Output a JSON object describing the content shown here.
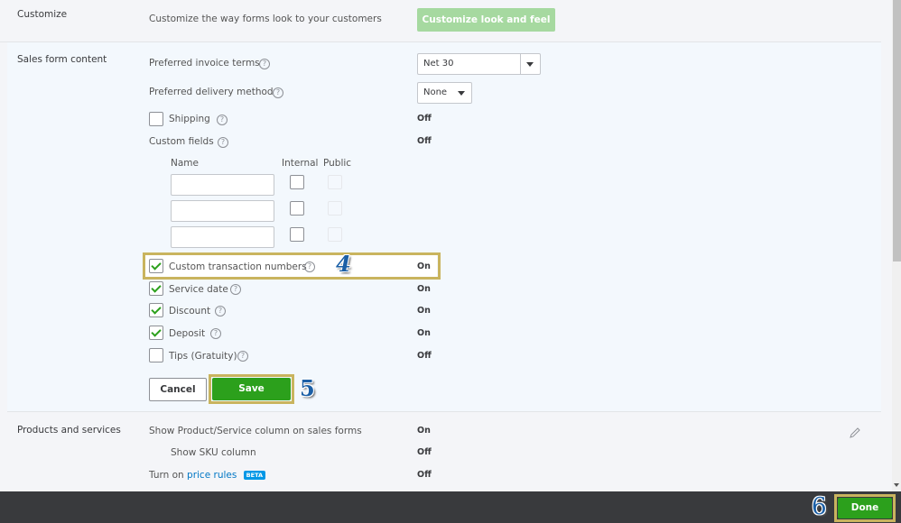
{
  "customize": {
    "section": "Customize",
    "description": "Customize the way forms look to your customers",
    "button": "Customize look and feel"
  },
  "sales": {
    "section": "Sales form content",
    "invoice_terms": {
      "label": "Preferred invoice terms",
      "value": "Net 30"
    },
    "delivery": {
      "label": "Preferred delivery method",
      "value": "None"
    },
    "shipping": {
      "label": "Shipping",
      "status": "Off",
      "checked": false
    },
    "custom_fields": {
      "label": "Custom fields",
      "status": "Off",
      "col_name": "Name",
      "col_internal": "Internal",
      "col_public": "Public"
    },
    "options": [
      {
        "label": "Custom transaction numbers",
        "status": "On",
        "checked": true
      },
      {
        "label": "Service date",
        "status": "On",
        "checked": true
      },
      {
        "label": "Discount",
        "status": "On",
        "checked": true
      },
      {
        "label": "Deposit",
        "status": "On",
        "checked": true
      },
      {
        "label": "Tips (Gratuity)",
        "status": "Off",
        "checked": false
      }
    ],
    "cancel": "Cancel",
    "save": "Save"
  },
  "products": {
    "section": "Products and services",
    "rows": [
      {
        "label": "Show Product/Service column on sales forms",
        "status": "On"
      },
      {
        "label": "Show SKU column",
        "status": "Off"
      }
    ],
    "price_prefix": "Turn on",
    "price_link": "price rules",
    "badge": "BETA",
    "price_status": "Off"
  },
  "footer": {
    "done": "Done"
  },
  "annotations": {
    "step4": "4",
    "step5": "5",
    "step6": "6"
  },
  "colors": {
    "green": "#2ca01c",
    "highlight": "#c9b45e",
    "footer": "#393a3d"
  }
}
